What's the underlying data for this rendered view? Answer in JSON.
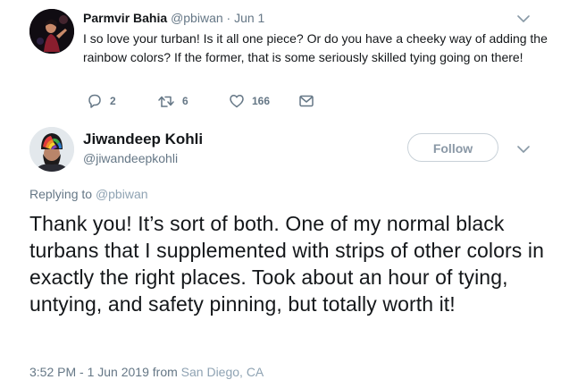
{
  "parent_tweet": {
    "display_name": "Parmvir Bahia",
    "handle": "@pbiwan",
    "separator": "·",
    "date": "Jun 1",
    "text": "I so love your turban! Is it all one piece? Or do you have a cheeky way of adding the rainbow colors? If the former, that is some seriously skilled tying going on there!",
    "actions": {
      "reply_count": "2",
      "retweet_count": "6",
      "like_count": "166"
    }
  },
  "main_tweet": {
    "display_name": "Jiwandeep Kohli",
    "handle": "@jiwandeepkohli",
    "follow_label": "Follow",
    "replying_prefix": "Replying to",
    "replying_to": "@pbiwan",
    "text": "Thank you! It’s sort of both. One of my normal black turbans that I supplemented with strips of other colors in exactly the right places. Took about an hour of tying, untying, and safety pinning, but totally worth it!",
    "timestamp": "3:52 PM - 1 Jun 2019",
    "from_label": "from",
    "location": "San Diego, CA"
  },
  "icons": {
    "caret": "chevron-down-icon",
    "reply": "reply-icon",
    "retweet": "retweet-icon",
    "like": "heart-icon",
    "dm": "envelope-icon"
  },
  "colors": {
    "text_primary": "#14171a",
    "text_secondary": "#657786",
    "link_muted": "#8fa3b3",
    "button_border": "#c8d1d8"
  }
}
